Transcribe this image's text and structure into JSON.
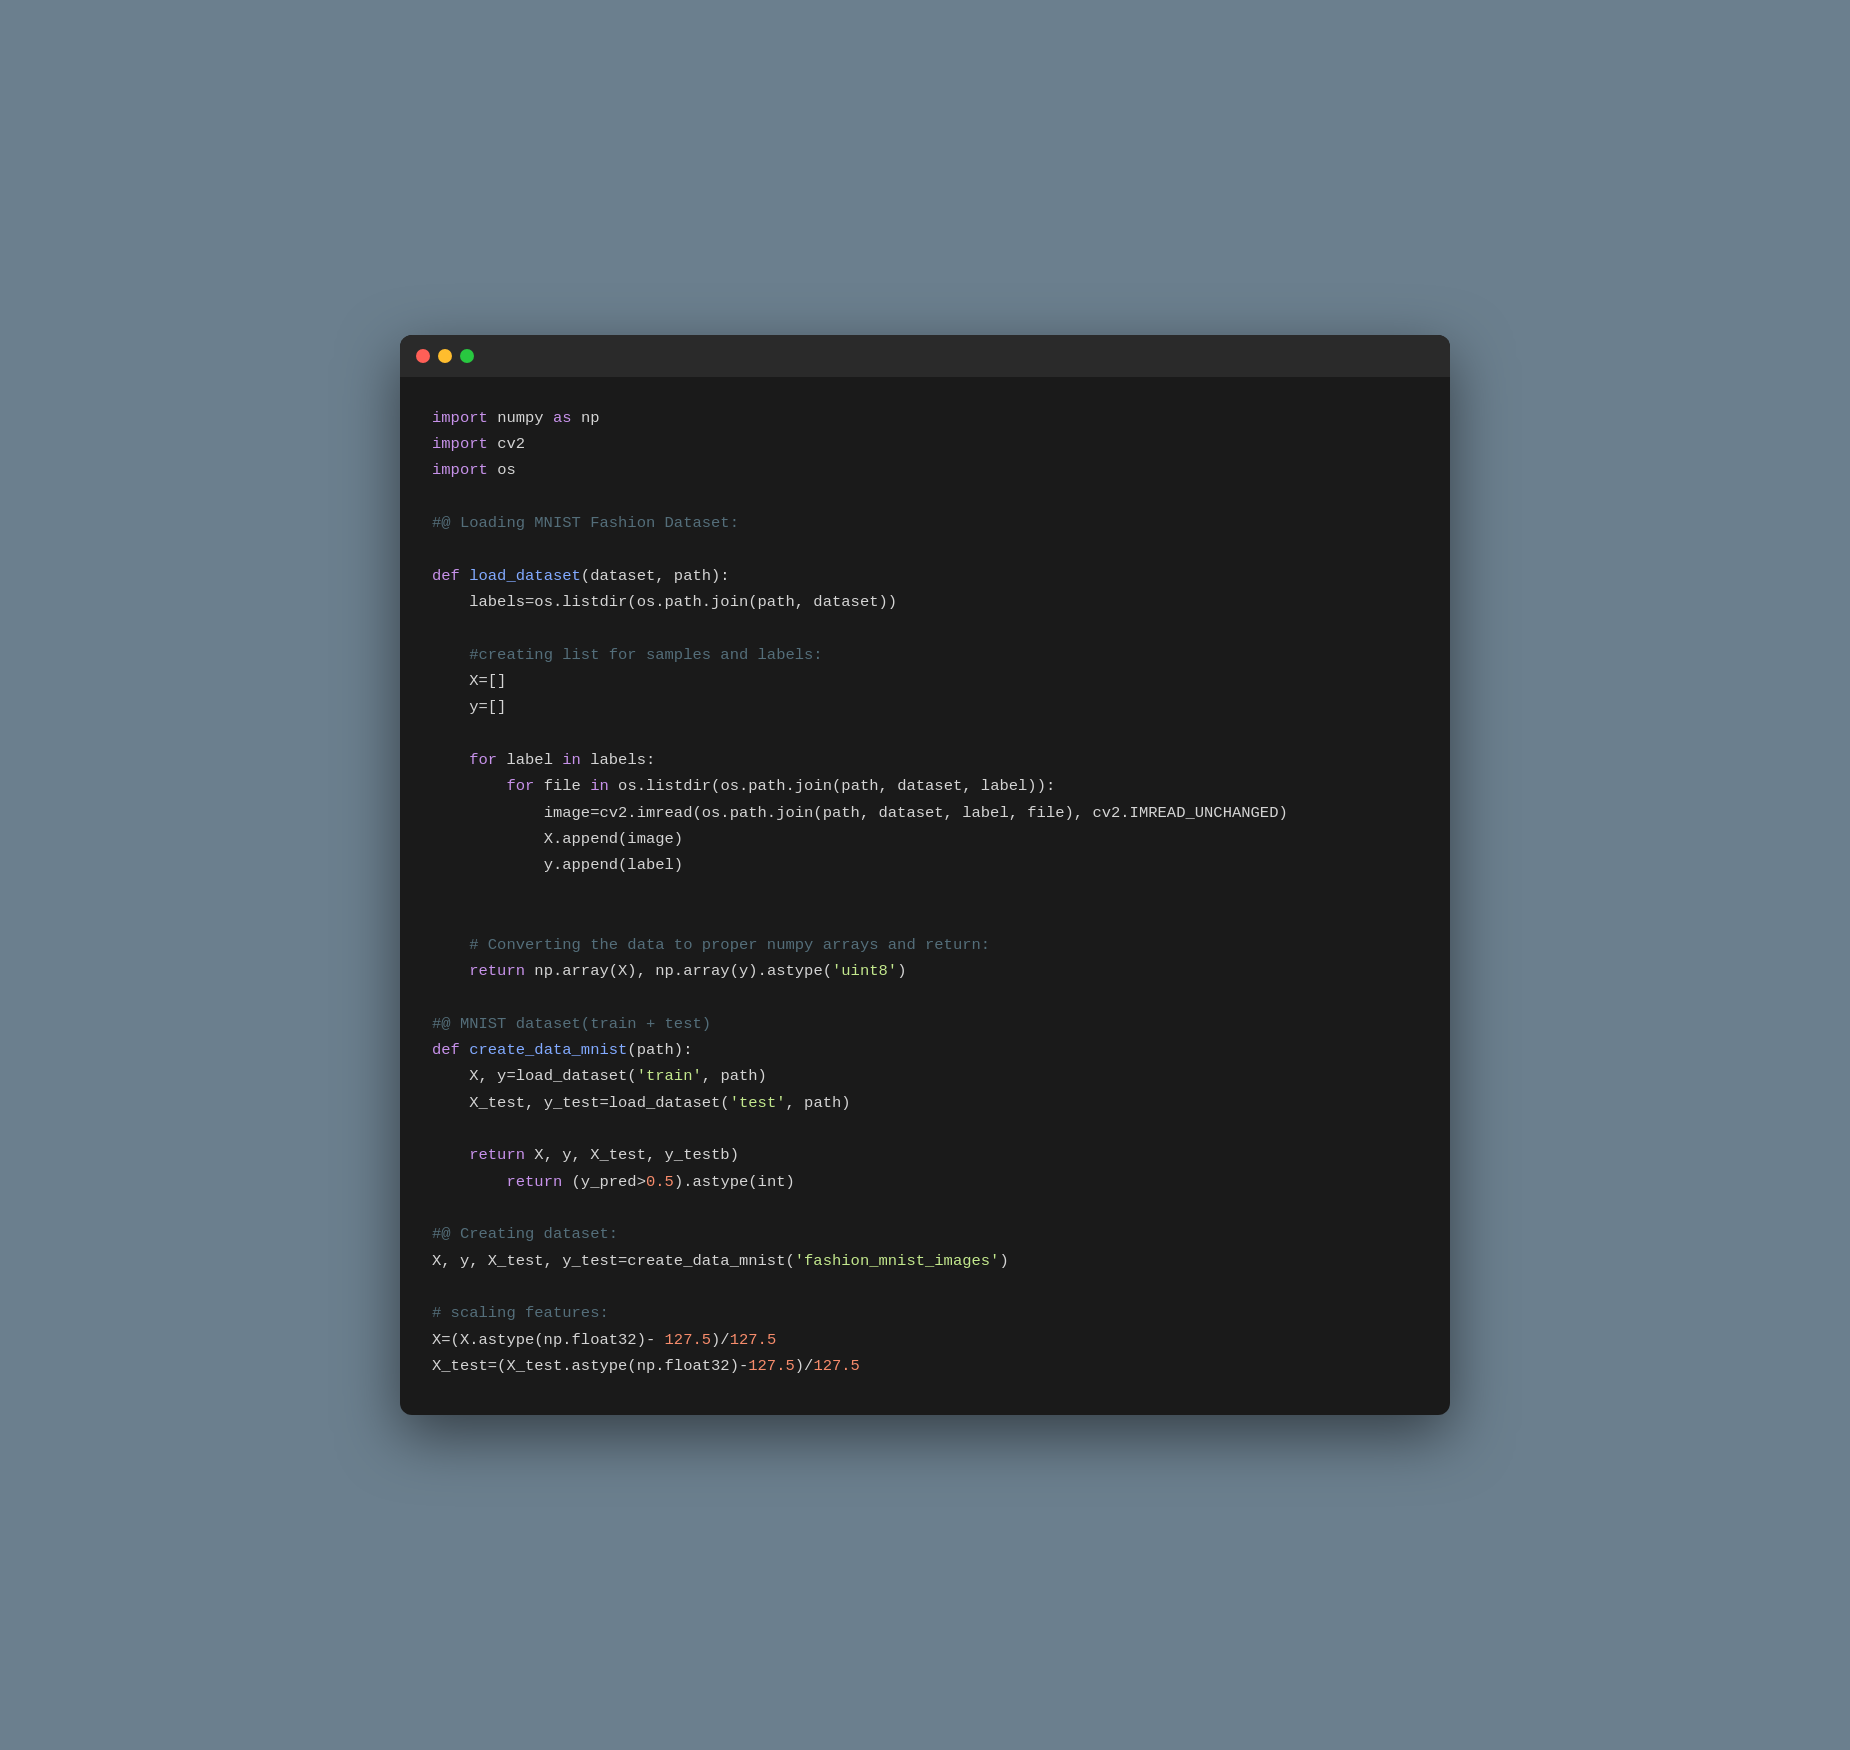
{
  "window": {
    "titlebar": {
      "dots": [
        "red",
        "yellow",
        "green"
      ]
    }
  },
  "code": {
    "lines": "code content rendered via HTML spans"
  }
}
